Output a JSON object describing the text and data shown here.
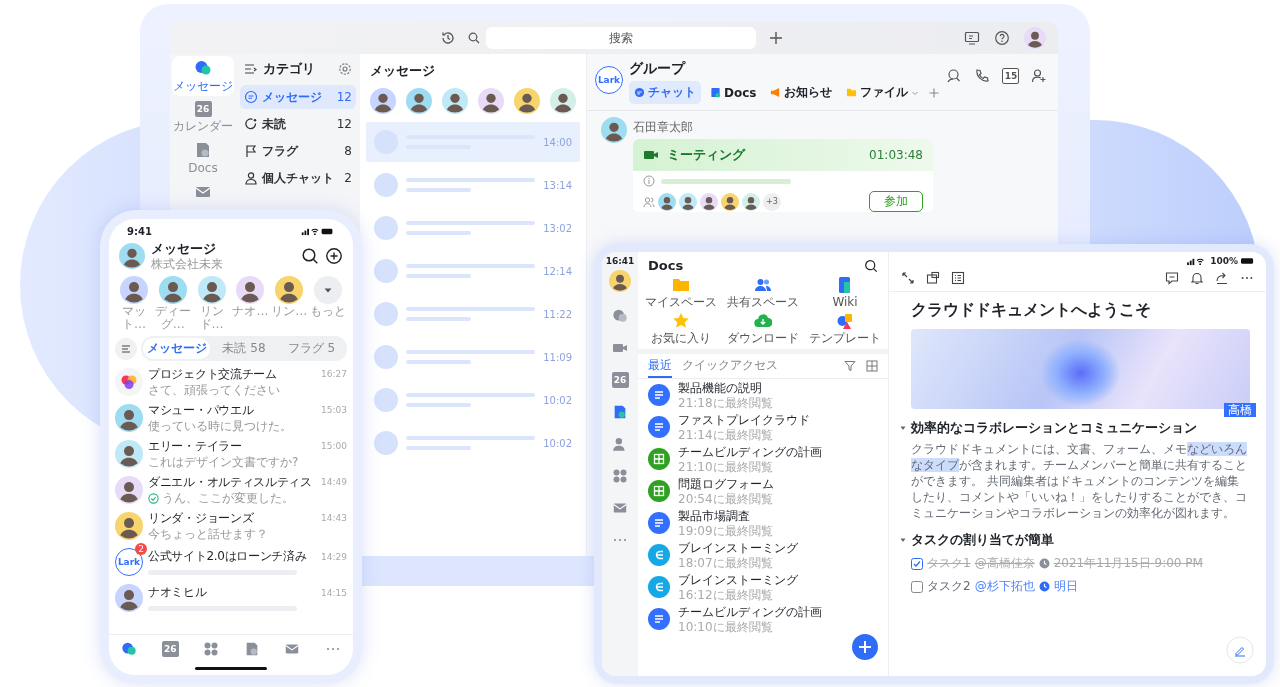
{
  "desktop": {
    "search": {
      "placeholder": "搜索"
    },
    "rail": [
      {
        "kind": "chat",
        "label": "メッセージ",
        "selected": true
      },
      {
        "kind": "calendar",
        "date": "26",
        "label": "カレンダー",
        "selected": false
      },
      {
        "kind": "docs",
        "label": "Docs",
        "selected": false
      },
      {
        "kind": "mail",
        "selected": false
      }
    ],
    "categories": {
      "title": "カテゴリ",
      "items": [
        {
          "kind": "chat",
          "label": "メッセージ",
          "count": "12",
          "selected": true
        },
        {
          "kind": "unread",
          "label": "未読",
          "count": "12",
          "selected": false
        },
        {
          "kind": "flag",
          "label": "フラグ",
          "count": "8",
          "selected": false
        },
        {
          "kind": "person",
          "label": "個人チャット",
          "count": "2",
          "selected": false
        }
      ]
    },
    "messages": {
      "title": "メッセージ",
      "rows": [
        {
          "time": "14:00",
          "selected": true
        },
        {
          "time": "13:14",
          "selected": false
        },
        {
          "time": "13:02",
          "selected": false
        },
        {
          "time": "12:14",
          "selected": false
        },
        {
          "time": "11:22",
          "selected": false
        },
        {
          "time": "11:09",
          "selected": false
        },
        {
          "time": "10:02",
          "selected": false
        },
        {
          "time": "10:02",
          "selected": false
        }
      ]
    },
    "chat": {
      "logo": "Lark",
      "title": "グループ",
      "calendar_date": "15",
      "tabs": [
        {
          "kind": "chat",
          "label": "チャット",
          "selected": true
        },
        {
          "kind": "docs",
          "label": "Docs",
          "selected": false
        },
        {
          "kind": "announce",
          "label": "お知らせ",
          "selected": false
        },
        {
          "kind": "files",
          "label": "ファイル",
          "dropdown": true,
          "selected": false
        }
      ],
      "message": {
        "sender": "石田章太郎",
        "meeting": {
          "title": "ミーティング",
          "duration": "01:03:48",
          "more_participants": "+3",
          "button": "参加"
        }
      }
    }
  },
  "phone": {
    "time": "9:41",
    "title": "メッセージ",
    "subtitle": "株式会社未来",
    "contacts": [
      {
        "kind": "person",
        "name": "マット…"
      },
      {
        "kind": "person",
        "name": "ディーグ…"
      },
      {
        "kind": "person",
        "name": "リンド…"
      },
      {
        "kind": "person",
        "name": "ナオ…"
      },
      {
        "kind": "person",
        "name": "リン…"
      },
      {
        "kind": "more",
        "name": "もっと"
      }
    ],
    "tabs": [
      {
        "label": "メッセージ",
        "selected": true
      },
      {
        "label": "未読 58",
        "selected": false
      },
      {
        "label": "フラグ 5",
        "selected": false
      }
    ],
    "chats": [
      {
        "kind": "group",
        "name": "プロジェクト交流チーム",
        "preview": "さて、頑張ってください",
        "time": "16:27"
      },
      {
        "kind": "person",
        "name": "マシュー・パウエル",
        "preview": "使っている時に見つけた。",
        "time": "15:03"
      },
      {
        "kind": "person",
        "name": "エリー・テイラー",
        "preview": "これはデザイン文書ですか?",
        "time": "15:00"
      },
      {
        "kind": "person",
        "name": "ダニエル・オルティスルティス",
        "preview": "うん、ここが変更した。",
        "time": "14:49",
        "read_check": true
      },
      {
        "kind": "person",
        "name": "リンダ・ジョーンズ",
        "preview": "今ちょっと話せます？",
        "time": "14:43"
      },
      {
        "kind": "lark",
        "logo": "Lark",
        "badge": "2",
        "name": "公式サイト2.0はローンチ済み",
        "time": "14:29"
      },
      {
        "kind": "person",
        "name": "ナオミヒル",
        "time": "14:15"
      }
    ],
    "nav": [
      {
        "kind": "chat",
        "selected": true
      },
      {
        "kind": "calendar",
        "date": "26",
        "selected": false
      },
      {
        "kind": "apps",
        "selected": false
      },
      {
        "kind": "docs",
        "selected": false
      },
      {
        "kind": "mail",
        "selected": false
      },
      {
        "kind": "more",
        "selected": false
      }
    ]
  },
  "tablet": {
    "time": "16:41",
    "battery": "100%",
    "rail": [
      {
        "kind": "chat",
        "selected": false
      },
      {
        "kind": "video",
        "selected": false
      },
      {
        "kind": "calendar",
        "date": "26",
        "selected": false
      },
      {
        "kind": "docs",
        "selected": true
      },
      {
        "kind": "contacts",
        "selected": false
      },
      {
        "kind": "apps",
        "selected": false
      },
      {
        "kind": "mail",
        "selected": false
      },
      {
        "kind": "more",
        "selected": false
      }
    ],
    "docs": {
      "title": "Docs",
      "shortcuts": [
        {
          "kind": "folder",
          "label": "マイスペース"
        },
        {
          "kind": "shared",
          "label": "共有スペース"
        },
        {
          "kind": "wiki",
          "label": "Wiki"
        },
        {
          "kind": "star",
          "label": "お気に入り"
        },
        {
          "kind": "download",
          "label": "ダウンロード"
        },
        {
          "kind": "template",
          "label": "テンプレート"
        }
      ],
      "tabs": [
        {
          "label": "最近",
          "selected": true
        },
        {
          "label": "クイックアクセス",
          "selected": false
        }
      ],
      "files": [
        {
          "kind": "doc",
          "name": "製品機能の説明",
          "meta": "21:18に最終閲覧"
        },
        {
          "kind": "doc",
          "name": "ファストプレイクラウド",
          "meta": "21:14に最終閲覧"
        },
        {
          "kind": "sheet",
          "name": "チームビルディングの計画",
          "meta": "21:10に最終閲覧"
        },
        {
          "kind": "sheet",
          "name": "問題ログフォーム",
          "meta": "20:54に最終閲覧"
        },
        {
          "kind": "doc",
          "name": "製品市場調査",
          "meta": "19:09に最終閲覧"
        },
        {
          "kind": "mindmap",
          "name": "ブレインストーミング",
          "meta": "18:07に最終閲覧"
        },
        {
          "kind": "mindmap",
          "name": "ブレインストーミング",
          "meta": "16:12に最終閲覧"
        },
        {
          "kind": "doc",
          "name": "チームビルディングの計画",
          "meta": "10:10に最終閲覧"
        }
      ]
    },
    "document": {
      "title": "クラウドドキュメントへようこそ",
      "sections": [
        {
          "heading": "効率的なコラボレーションとコミュニケーション",
          "cursor": "高橋",
          "paragraph": [
            {
              "text": "クラウドドキュメントには、文書、フォーム、メモ",
              "highlighted": false
            },
            {
              "text": "などいろんなタイプ",
              "highlighted": true
            },
            {
              "text": "が含まれます。チームメンバーと簡単に共有することができます。 共同編集者はドキュメントのコンテンツを編集したり、コメントや「いいね！」をしたりすることができ、コミュニケーションやコラボレーションの効率化が図れます。",
              "highlighted": false
            }
          ]
        },
        {
          "heading": "タスクの割り当てが簡単",
          "tasks": [
            {
              "label": "タスク1",
              "assignee": "@高橋佳奈",
              "due": "2021年11月15日 9:00 PM",
              "checked": true
            },
            {
              "label": "タスク2",
              "assignee": "@杉下拓也",
              "due": "明日",
              "checked": false
            }
          ]
        }
      ]
    }
  }
}
